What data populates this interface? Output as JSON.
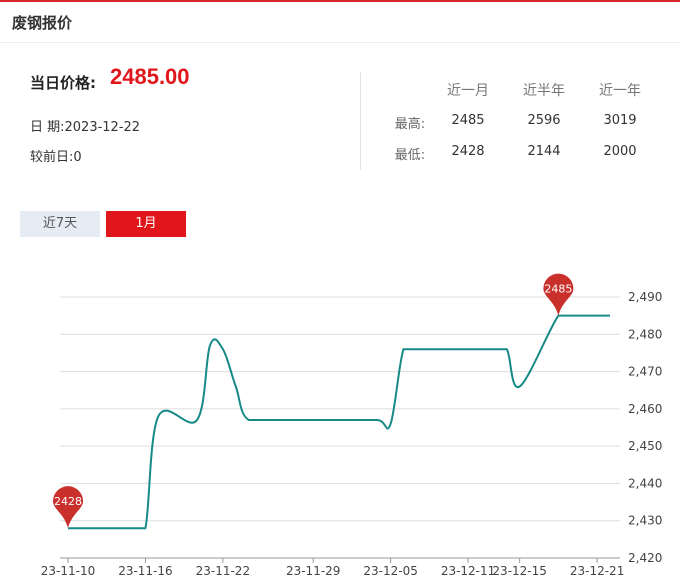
{
  "header": {
    "title": "废钢报价"
  },
  "summary": {
    "price_label": "当日价格:",
    "price_value": "2485.00",
    "date_line": "日  期:2023-12-22",
    "change_line": "较前日:0"
  },
  "stats": {
    "columns": [
      "近一月",
      "近半年",
      "近一年"
    ],
    "rows": [
      {
        "label": "最高:",
        "values": [
          "2485",
          "2596",
          "3019"
        ]
      },
      {
        "label": "最低:",
        "values": [
          "2428",
          "2144",
          "2000"
        ]
      }
    ]
  },
  "tabs": [
    {
      "label": "近7天",
      "active": false
    },
    {
      "label": "1月",
      "active": true
    }
  ],
  "colors": {
    "accent": "#e0161b",
    "line": "#168a87",
    "marker": "#c9302c",
    "grid": "#dddddd"
  },
  "chart_data": {
    "type": "line",
    "x_tick_labels": [
      "23-11-10",
      "23-11-16",
      "23-11-22",
      "23-11-29",
      "23-12-05",
      "23-12-11",
      "23-12-15",
      "23-12-21"
    ],
    "y_tick_labels": [
      "2,420",
      "2,430",
      "2,440",
      "2,450",
      "2,460",
      "2,470",
      "2,480",
      "2,490"
    ],
    "ylim": [
      2420,
      2490
    ],
    "x": [
      "23-11-10",
      "23-11-13",
      "23-11-14",
      "23-11-15",
      "23-11-16",
      "23-11-17",
      "23-11-20",
      "23-11-21",
      "23-11-22",
      "23-11-23",
      "23-11-24",
      "23-11-27",
      "23-11-28",
      "23-11-29",
      "23-11-30",
      "23-12-01",
      "23-12-04",
      "23-12-05",
      "23-12-06",
      "23-12-07",
      "23-12-08",
      "23-12-11",
      "23-12-12",
      "23-12-13",
      "23-12-14",
      "23-12-15",
      "23-12-18",
      "23-12-19",
      "23-12-20",
      "23-12-21",
      "23-12-22"
    ],
    "values": [
      2428,
      2428,
      2428,
      2428,
      2428,
      2458,
      2457,
      2477,
      2476,
      2466,
      2457,
      2457,
      2457,
      2457,
      2457,
      2457,
      2457,
      2456,
      2476,
      2476,
      2476,
      2476,
      2476,
      2476,
      2476,
      2466,
      2485,
      2485,
      2485,
      2485,
      2485
    ],
    "markers": [
      {
        "x": "23-11-10",
        "value": 2428,
        "label": "2428"
      },
      {
        "x": "23-12-18",
        "value": 2485,
        "label": "2485"
      }
    ],
    "grid": true
  }
}
